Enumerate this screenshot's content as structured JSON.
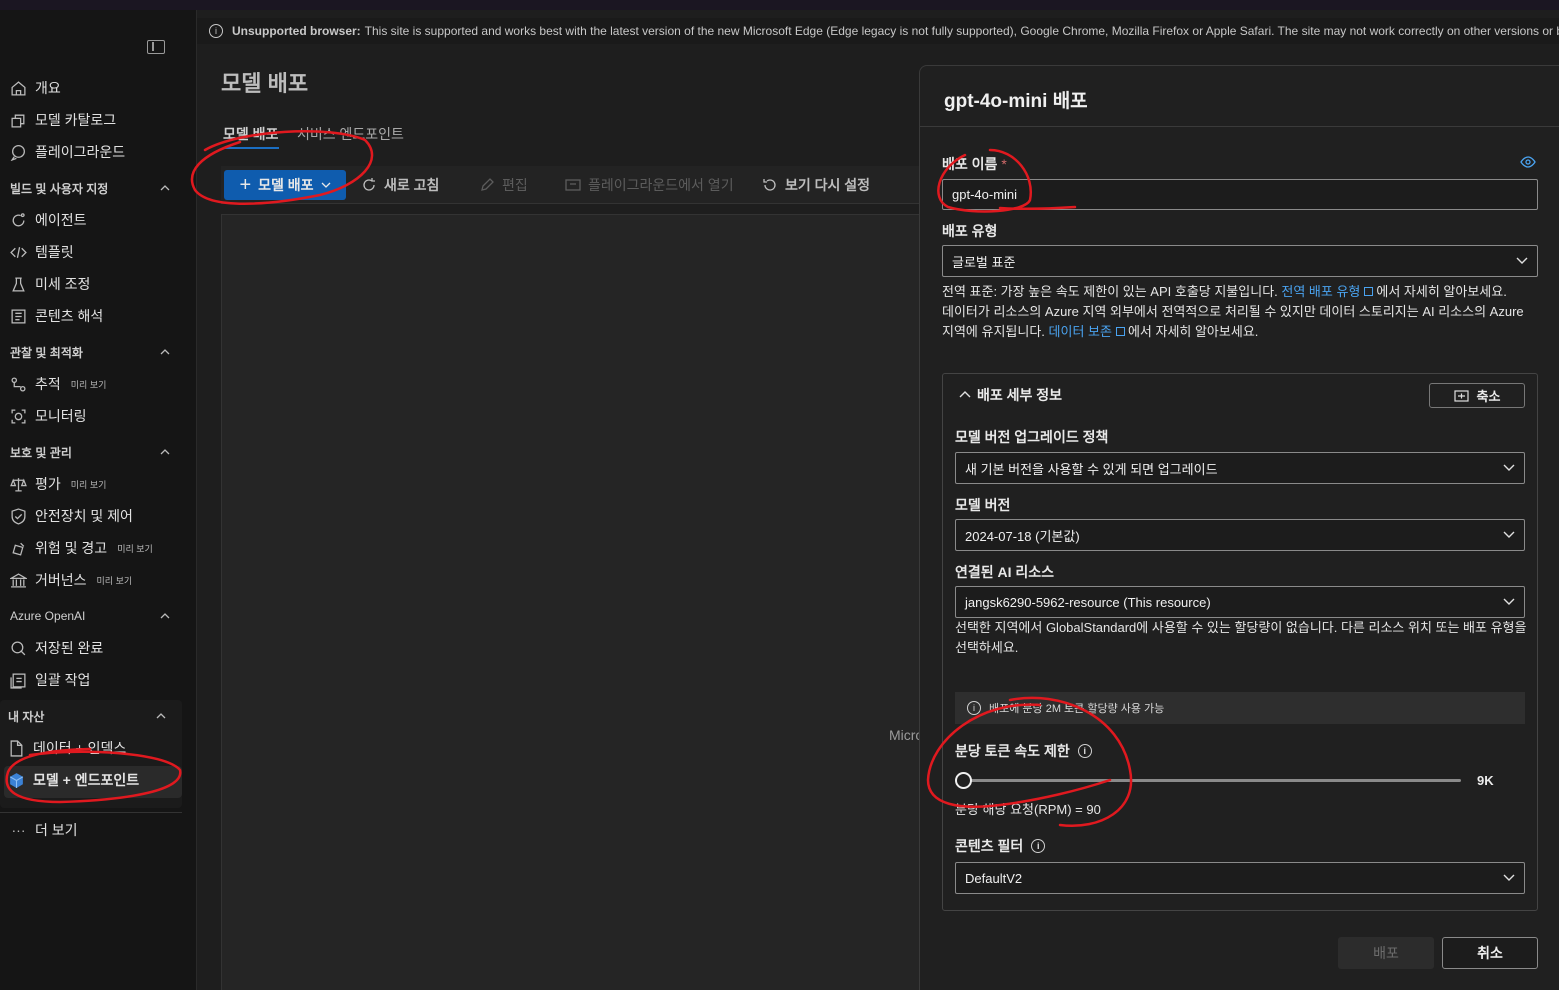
{
  "banner": {
    "bold": "Unsupported browser:",
    "text": "This site is supported and works best with the latest version of the new Microsoft Edge (Edge legacy is not fully supported), Google Chrome, Mozilla Firefox or Apple Safari. The site may not work correctly on other versions or bro"
  },
  "sidebar": {
    "items_top": [
      {
        "label": "개요",
        "icon": "home-icon"
      },
      {
        "label": "모델 카탈로그",
        "icon": "cube-catalog-icon"
      },
      {
        "label": "플레이그라운드",
        "icon": "chat-icon"
      }
    ],
    "section_build": "빌드 및 사용자 지정",
    "items_build": [
      {
        "label": "에이전트",
        "icon": "agent-icon"
      },
      {
        "label": "템플릿",
        "icon": "code-icon"
      },
      {
        "label": "미세 조정",
        "icon": "beaker-icon"
      },
      {
        "label": "콘텐츠 해석",
        "icon": "content-icon"
      }
    ],
    "section_observe": "관찰 및 최적화",
    "items_observe": [
      {
        "label": "추적",
        "badge": "미리 보기",
        "icon": "trace-icon"
      },
      {
        "label": "모니터링",
        "icon": "monitor-icon"
      }
    ],
    "section_protect": "보호 및 관리",
    "items_protect": [
      {
        "label": "평가",
        "badge": "미리 보기",
        "icon": "scale-icon"
      },
      {
        "label": "안전장치 및 제어",
        "icon": "shield-icon"
      },
      {
        "label": "위험 및 경고",
        "badge": "미리 보기",
        "icon": "alert-icon"
      },
      {
        "label": "거버넌스",
        "badge": "미리 보기",
        "icon": "governance-icon"
      }
    ],
    "section_openai": "Azure OpenAI",
    "items_openai": [
      {
        "label": "저장된 완료",
        "icon": "stored-icon"
      },
      {
        "label": "일괄 작업",
        "icon": "batch-icon"
      }
    ],
    "section_mine": "내 자산",
    "items_mine": [
      {
        "label": "데이터 + 인덱스",
        "icon": "document-icon"
      },
      {
        "label": "모델 + 엔드포인트",
        "icon": "model-cube-icon"
      }
    ],
    "more": "더 보기"
  },
  "main": {
    "title": "모델 배포",
    "tabs": [
      "모델 배포",
      "서비스 엔드포인트"
    ],
    "toolbar": {
      "deploy": "모델 배포",
      "refresh": "새로 고침",
      "edit": "편집",
      "open_playground": "플레이그라운드에서 열기",
      "reset_view": "보기 다시 설정"
    },
    "partial_text": "Micro"
  },
  "panel": {
    "title": "gpt-4o-mini 배포",
    "deploy_name_label": "배포 이름",
    "required_mark": "*",
    "deploy_name_value": "gpt-4o-mini",
    "deploy_type_label": "배포 유형",
    "deploy_type_value": "글로벌 표준",
    "desc1_a": "전역 표준: 가장 높은 속도 제한이 있는 API 호출당 지불입니다.",
    "desc1_link": "전역 배포 유형",
    "desc1_b": "에서 자세히 알아보세요.",
    "desc2_a": "데이터가 리소스의 Azure 지역 외부에서 전역적으로 처리될 수 있지만 데이터 스토리지는 AI 리소스의 Azure 지역에 유지됩니다.",
    "desc2_link": "데이터 보존",
    "desc2_b": "에서 자세히 알아보세요.",
    "details_title": "배포 세부 정보",
    "collapse_label": "축소",
    "upgrade_policy_label": "모델 버전 업그레이드 정책",
    "upgrade_policy_value": "새 기본 버전을 사용할 수 있게 되면 업그레이드",
    "model_version_label": "모델 버전",
    "model_version_value": "2024-07-18 (기본값)",
    "resource_label": "연결된 AI 리소스",
    "resource_value": "jangsk6290-5962-resource (This resource)",
    "resource_note": "선택한 지역에서 GlobalStandard에 사용할 수 있는 할당량이 없습니다. 다른 리소스 위치 또는 배포 유형을 선택하세요.",
    "quota_info": "배포에 분당 2M 토큰 할당량 사용 가능",
    "rate_limit_label": "분당 토큰 속도 제한",
    "rate_limit_value": "9K",
    "rate_limit_fraction": 0.0,
    "rpm_text": "분당 해당 요청(RPM) = 90",
    "content_filter_label": "콘텐츠 필터",
    "content_filter_value": "DefaultV2",
    "deploy_button": "배포",
    "cancel_button": "취소"
  },
  "colors": {
    "accent": "#0f5cae",
    "link": "#4aa3f0",
    "annotation": "#e0191f"
  }
}
